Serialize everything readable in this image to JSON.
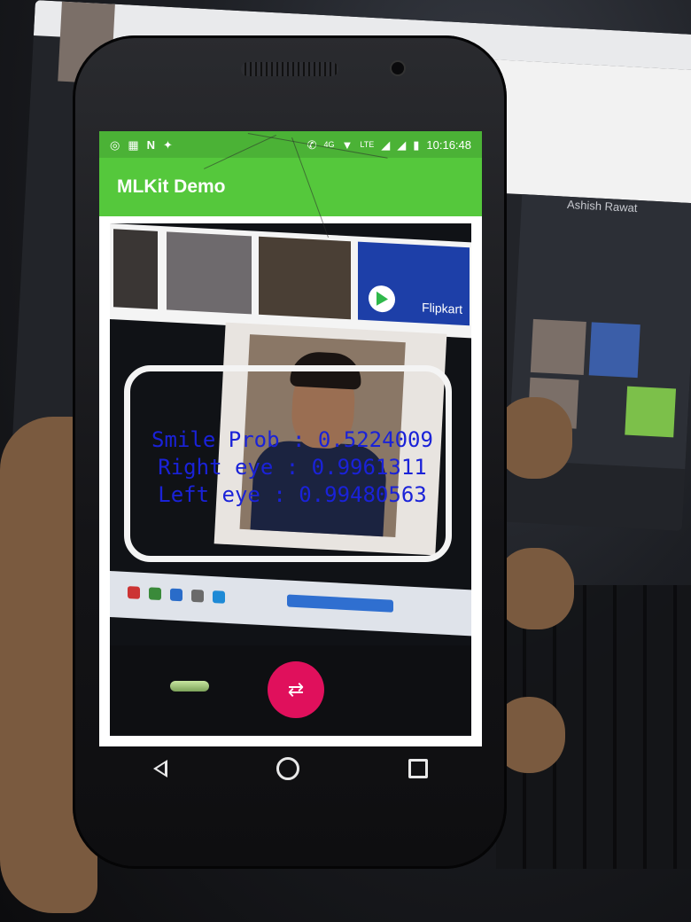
{
  "background_monitor": {
    "profile_name": "Ashish Rawat"
  },
  "status_bar": {
    "time": "10:16:48",
    "network": "4G",
    "network2": "LTE",
    "left_icons": [
      "instagram-icon",
      "keypad-icon",
      "n-icon",
      "twitter-icon"
    ],
    "right_icons": [
      "call-icon",
      "wifi-icon",
      "signal-icon",
      "signal-icon",
      "battery-icon"
    ]
  },
  "app": {
    "title": "MLKit Demo",
    "accent": "#55c83c",
    "status_color": "#4bb236"
  },
  "camera_preview": {
    "ad_label": "Flipkart",
    "overlay_color": "#1a22d8",
    "results": {
      "smile": "Smile Prob : 0.5224009",
      "right_eye": "Right eye : 0.9961311",
      "left_eye": "Left eye : 0.99480563"
    }
  },
  "controls": {
    "toggle_icon": "facing-toggle-icon",
    "shutter_icon": "switch-camera-icon",
    "shutter_color": "#e0105c"
  },
  "nav": {
    "back": "back-icon",
    "home": "home-icon",
    "recents": "recents-icon"
  }
}
